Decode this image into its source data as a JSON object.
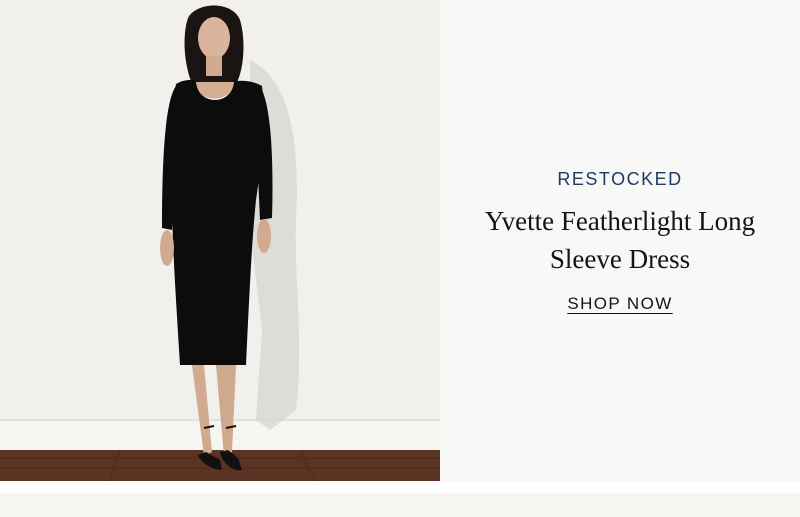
{
  "banner": {
    "eyebrow": "RESTOCKED",
    "title": "Yvette Featherlight Long Sleeve Dress",
    "cta_label": "SHOP NOW",
    "eyebrow_color": "#1f3a64",
    "photo_alt": "Model wearing black long sleeve midi dress"
  }
}
